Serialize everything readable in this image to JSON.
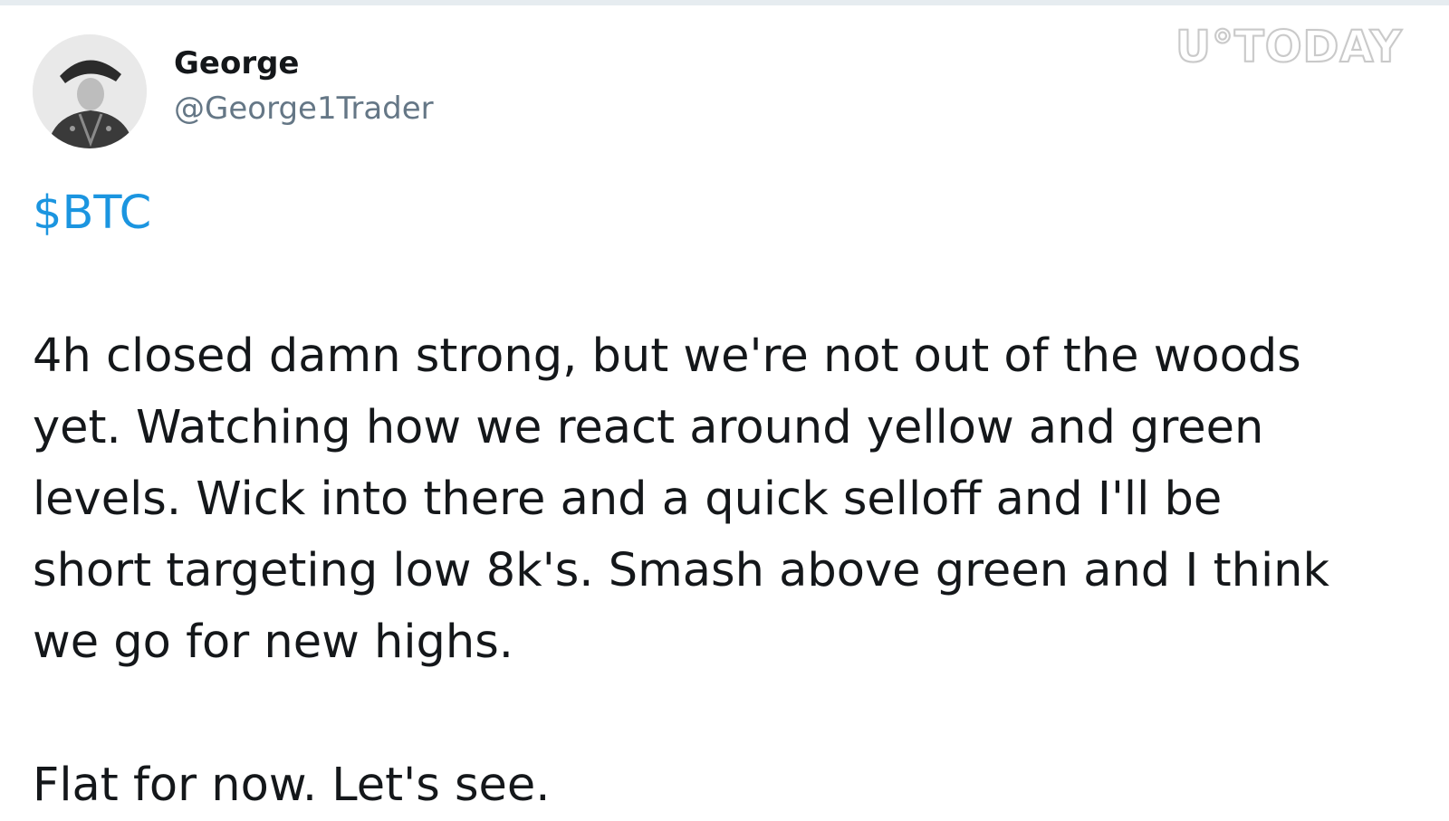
{
  "tweet": {
    "author": {
      "name": "George",
      "handle": "@George1Trader",
      "avatar_icon": "portrait-avatar"
    },
    "cashtag": "$BTC",
    "body_lines": [
      "4h closed damn strong, but we're not out of the woods",
      "yet. Watching how we react around yellow and green",
      "levels. Wick into there and a quick selloff and I'll be",
      "short targeting low 8k's. Smash above green and I think",
      "we go for new highs."
    ],
    "closing_line": "Flat for now. Let's see."
  },
  "watermark": {
    "text": "U°TODAY"
  },
  "colors": {
    "link": "#1b95e0",
    "text": "#14171a",
    "muted": "#657786"
  }
}
